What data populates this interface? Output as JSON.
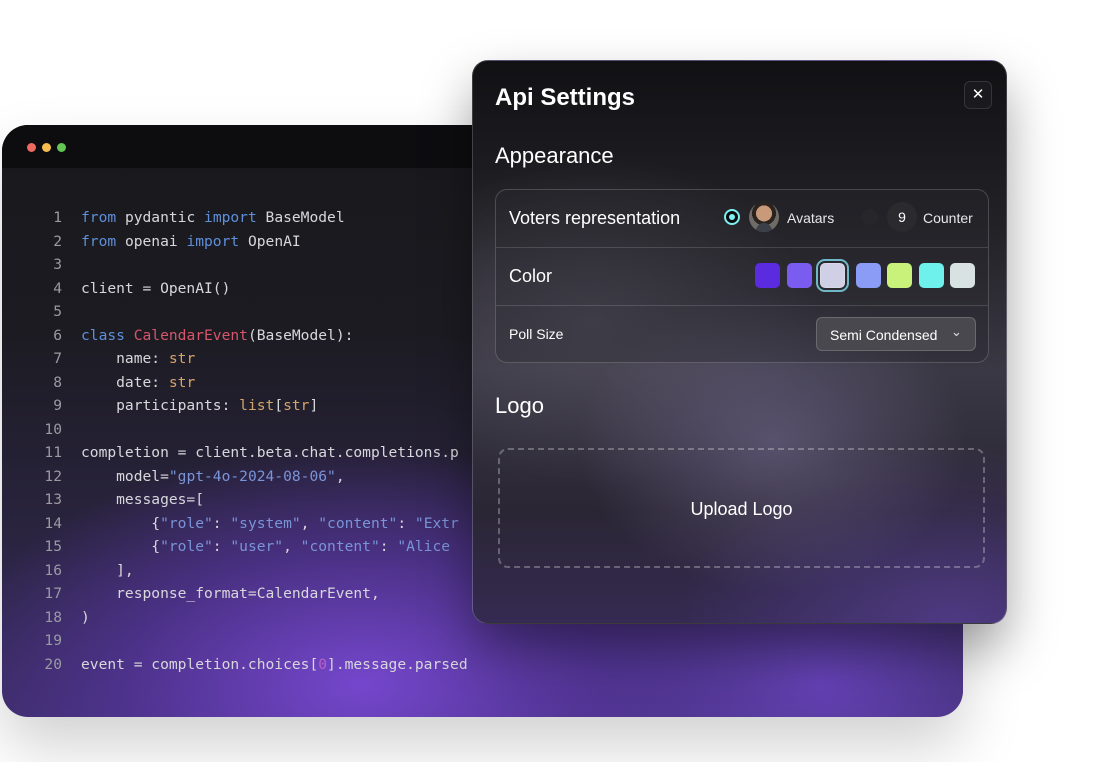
{
  "editor": {
    "window_controls": [
      "close",
      "minimize",
      "maximize"
    ],
    "lines": [
      {
        "n": "1",
        "tokens": [
          {
            "t": "from",
            "c": "kw"
          },
          {
            "t": " pydantic "
          },
          {
            "t": "import",
            "c": "kw"
          },
          {
            "t": " BaseModel"
          }
        ]
      },
      {
        "n": "2",
        "tokens": [
          {
            "t": "from",
            "c": "kw"
          },
          {
            "t": " openai "
          },
          {
            "t": "import",
            "c": "kw"
          },
          {
            "t": " OpenAI"
          }
        ]
      },
      {
        "n": "3",
        "tokens": []
      },
      {
        "n": "4",
        "tokens": [
          {
            "t": "client = OpenAI()"
          }
        ]
      },
      {
        "n": "5",
        "tokens": []
      },
      {
        "n": "6",
        "tokens": [
          {
            "t": "class",
            "c": "kw"
          },
          {
            "t": " "
          },
          {
            "t": "CalendarEvent",
            "c": "cls"
          },
          {
            "t": "(BaseModel):"
          }
        ]
      },
      {
        "n": "7",
        "tokens": [
          {
            "t": "    name: "
          },
          {
            "t": "str",
            "c": "ty"
          }
        ]
      },
      {
        "n": "8",
        "tokens": [
          {
            "t": "    date: "
          },
          {
            "t": "str",
            "c": "ty"
          }
        ]
      },
      {
        "n": "9",
        "tokens": [
          {
            "t": "    participants: "
          },
          {
            "t": "list",
            "c": "ty"
          },
          {
            "t": "["
          },
          {
            "t": "str",
            "c": "ty"
          },
          {
            "t": "]"
          }
        ]
      },
      {
        "n": "10",
        "tokens": []
      },
      {
        "n": "11",
        "tokens": [
          {
            "t": "completion = client.beta.chat.completions.p"
          }
        ]
      },
      {
        "n": "12",
        "tokens": [
          {
            "t": "    model="
          },
          {
            "t": "\"gpt-4o-2024-08-06\"",
            "c": "str"
          },
          {
            "t": ","
          }
        ]
      },
      {
        "n": "13",
        "tokens": [
          {
            "t": "    messages=["
          }
        ]
      },
      {
        "n": "14",
        "tokens": [
          {
            "t": "        {"
          },
          {
            "t": "\"role\"",
            "c": "str"
          },
          {
            "t": ": "
          },
          {
            "t": "\"system\"",
            "c": "str"
          },
          {
            "t": ", "
          },
          {
            "t": "\"content\"",
            "c": "str"
          },
          {
            "t": ": "
          },
          {
            "t": "\"Extr",
            "c": "str"
          }
        ]
      },
      {
        "n": "15",
        "tokens": [
          {
            "t": "        {"
          },
          {
            "t": "\"role\"",
            "c": "str"
          },
          {
            "t": ": "
          },
          {
            "t": "\"user\"",
            "c": "str"
          },
          {
            "t": ", "
          },
          {
            "t": "\"content\"",
            "c": "str"
          },
          {
            "t": ": "
          },
          {
            "t": "\"Alice ",
            "c": "str"
          }
        ]
      },
      {
        "n": "16",
        "tokens": [
          {
            "t": "    ],"
          }
        ]
      },
      {
        "n": "17",
        "tokens": [
          {
            "t": "    response_format=CalendarEvent,"
          }
        ]
      },
      {
        "n": "18",
        "tokens": [
          {
            "t": ")"
          }
        ]
      },
      {
        "n": "19",
        "tokens": []
      },
      {
        "n": "20",
        "tokens": [
          {
            "t": "event = completion.choices["
          },
          {
            "t": "0",
            "c": "num"
          },
          {
            "t": "].message.parsed"
          }
        ]
      }
    ]
  },
  "dialog": {
    "title": "Api Settings",
    "close_icon": "close-icon",
    "close_glyph": "✕",
    "appearance_heading": "Appearance",
    "voters": {
      "label": "Voters representation",
      "options": {
        "avatars": {
          "label": "Avatars",
          "selected": true
        },
        "counter": {
          "label": "Counter",
          "badge": "9",
          "selected": false
        }
      }
    },
    "color": {
      "label": "Color",
      "swatches": [
        "#5b2be0",
        "#7b5cf0",
        "#cfcfe6",
        "#8b9cf6",
        "#c8f27a",
        "#6ef0ec",
        "#d8e2e2"
      ],
      "selected_index": 2
    },
    "poll_size": {
      "label": "Poll Size",
      "value": "Semi Condensed",
      "chevron": "⌄"
    },
    "logo_heading": "Logo",
    "upload_label": "Upload Logo"
  }
}
